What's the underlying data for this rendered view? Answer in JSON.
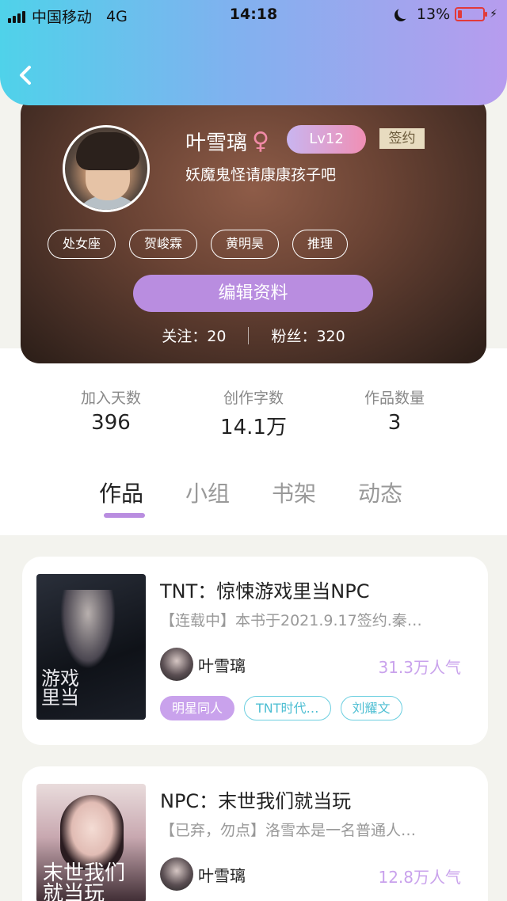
{
  "status_bar": {
    "carrier": "中国移动",
    "network": "4G",
    "time": "14:18",
    "battery": "13%"
  },
  "profile": {
    "name": "叶雪璃",
    "gender_symbol": "♀",
    "level": "Lv12",
    "badge": "签约",
    "bio": "妖魔鬼怪请康康孩子吧",
    "tags": [
      "处女座",
      "贺峻霖",
      "黄明昊",
      "推理"
    ],
    "edit_label": "编辑资料",
    "follow_label": "关注：",
    "follow_count": "20",
    "fans_label": "粉丝：",
    "fans_count": "320"
  },
  "stats": [
    {
      "label": "加入天数",
      "value": "396"
    },
    {
      "label": "创作字数",
      "value": "14.1万"
    },
    {
      "label": "作品数量",
      "value": "3"
    }
  ],
  "tabs": [
    "作品",
    "小组",
    "书架",
    "动态"
  ],
  "active_tab": "作品",
  "books": [
    {
      "title": "TNT：惊悚游戏里当NPC",
      "desc": "【连载中】本书于2021.9.17签约.秦…",
      "author": "叶雪璃",
      "popularity": "31.3万人气",
      "tags": [
        "明星同人",
        "TNT时代…",
        "刘耀文"
      ],
      "cover_text": "游戏\n里当"
    },
    {
      "title": "NPC：末世我们就当玩",
      "desc": "【已弃，勿点】洛雪本是一名普通人…",
      "author": "叶雪璃",
      "popularity": "12.8万人气",
      "cover_text": "末世我们\n就当玩"
    }
  ],
  "colors": {
    "accent": "#b98de0",
    "header_start": "#4fd2ea",
    "header_end": "#b79cee",
    "tag_cyan": "#4fbfd3"
  }
}
